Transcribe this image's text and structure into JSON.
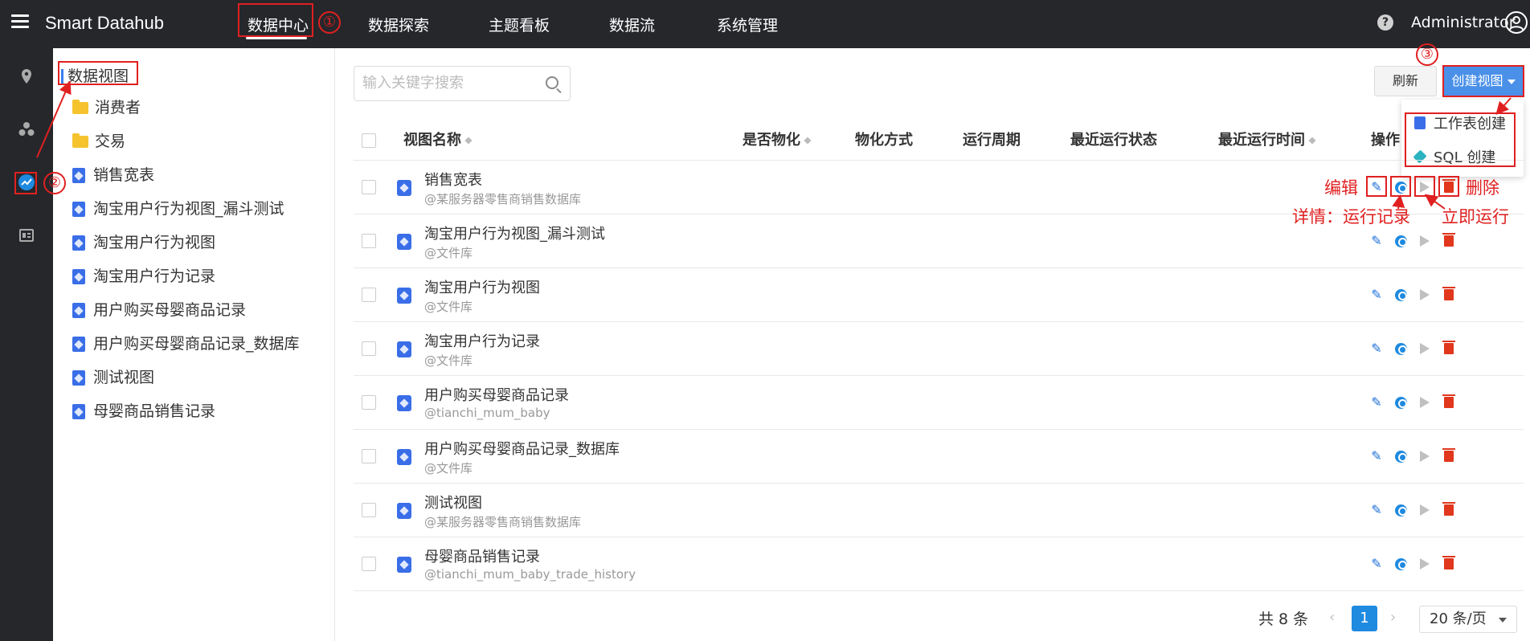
{
  "app": {
    "brand": "Smart Datahub",
    "nav": [
      "数据中心",
      "数据探索",
      "主题看板",
      "数据流",
      "系统管理"
    ],
    "help_symbol": "?",
    "username": "Administrator"
  },
  "rail_icons": [
    "location-pin-icon",
    "cluster-icon",
    "dataview-icon",
    "report-icon"
  ],
  "tree": {
    "root": "数据视图",
    "items": [
      {
        "label": "消费者",
        "type": "folder"
      },
      {
        "label": "交易",
        "type": "folder"
      },
      {
        "label": "销售宽表",
        "type": "view"
      },
      {
        "label": "淘宝用户行为视图_漏斗测试",
        "type": "view"
      },
      {
        "label": "淘宝用户行为视图",
        "type": "view"
      },
      {
        "label": "淘宝用户行为记录",
        "type": "view"
      },
      {
        "label": "用户购买母婴商品记录",
        "type": "view"
      },
      {
        "label": "用户购买母婴商品记录_数据库",
        "type": "view"
      },
      {
        "label": "测试视图",
        "type": "view"
      },
      {
        "label": "母婴商品销售记录",
        "type": "view"
      }
    ]
  },
  "search": {
    "placeholder": "输入关键字搜索"
  },
  "toolbar": {
    "refresh_label": "刷新",
    "create_label": "创建视图"
  },
  "create_menu": {
    "items": [
      "工作表创建",
      "SQL 创建"
    ]
  },
  "table": {
    "columns": [
      "视图名称",
      "是否物化",
      "物化方式",
      "运行周期",
      "最近运行状态",
      "最近运行时间",
      "操作"
    ],
    "rows": [
      {
        "name": "销售宽表",
        "source": "@某服务器零售商销售数据库"
      },
      {
        "name": "淘宝用户行为视图_漏斗测试",
        "source": "@文件库"
      },
      {
        "name": "淘宝用户行为视图",
        "source": "@文件库"
      },
      {
        "name": "淘宝用户行为记录",
        "source": "@文件库"
      },
      {
        "name": "用户购买母婴商品记录",
        "source": "@tianchi_mum_baby"
      },
      {
        "name": "用户购买母婴商品记录_数据库",
        "source": "@文件库"
      },
      {
        "name": "测试视图",
        "source": "@某服务器零售商销售数据库"
      },
      {
        "name": "母婴商品销售记录",
        "source": "@tianchi_mum_baby_trade_history"
      }
    ]
  },
  "pagination": {
    "total": "共 8 条",
    "prev": "‹",
    "current": "1",
    "next": "›",
    "page_size": "20 条/页"
  },
  "annotations": {
    "step1": "①",
    "step2": "②",
    "step3": "③",
    "edit": "编辑",
    "delete": "删除",
    "details": "详情：运行记录",
    "run_now": "立即运行"
  },
  "colors": {
    "topbar": "#25272b",
    "accent": "#4a90e8",
    "annotation": "#e02020",
    "delete": "#e0371d",
    "folder": "#f5c32e"
  }
}
